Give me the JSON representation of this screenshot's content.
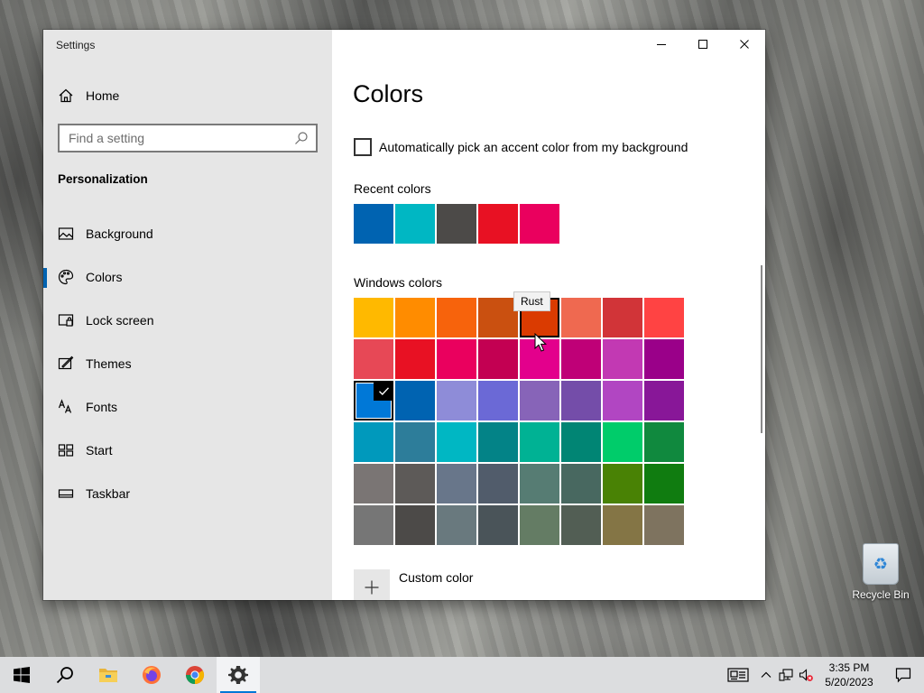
{
  "window": {
    "title": "Settings",
    "home_label": "Home",
    "search_placeholder": "Find a setting",
    "section_label": "Personalization",
    "nav_items": [
      {
        "label": "Background",
        "icon": "picture-icon"
      },
      {
        "label": "Colors",
        "icon": "palette-icon",
        "active": true
      },
      {
        "label": "Lock screen",
        "icon": "lock-screen-icon"
      },
      {
        "label": "Themes",
        "icon": "themes-icon"
      },
      {
        "label": "Fonts",
        "icon": "fonts-icon"
      },
      {
        "label": "Start",
        "icon": "start-icon"
      },
      {
        "label": "Taskbar",
        "icon": "taskbar-icon"
      }
    ],
    "caption_buttons": [
      "minimize",
      "maximize",
      "close"
    ]
  },
  "colors_page": {
    "title": "Colors",
    "auto_pick_label": "Automatically pick an accent color from my background",
    "auto_pick_checked": false,
    "recent_label": "Recent colors",
    "recent_colors": [
      "#0063b1",
      "#00b7c3",
      "#4c4a48",
      "#e81123",
      "#ea005e"
    ],
    "windows_label": "Windows colors",
    "windows_colors": [
      [
        "#ffb900",
        "#ff8c00",
        "#f7630c",
        "#ca5010",
        "#da3b01",
        "#ef6950",
        "#d13438",
        "#ff4343"
      ],
      [
        "#e74856",
        "#e81123",
        "#ea005e",
        "#c30052",
        "#e3008c",
        "#bf0077",
        "#c239b3",
        "#9a0089"
      ],
      [
        "#0078d7",
        "#0063b1",
        "#8e8cd8",
        "#6b69d6",
        "#8764b8",
        "#744da9",
        "#b146c2",
        "#881798"
      ],
      [
        "#0099bc",
        "#2d7d9a",
        "#00b7c3",
        "#038387",
        "#00b294",
        "#018574",
        "#00cc6a",
        "#10893e"
      ],
      [
        "#7a7574",
        "#5d5a58",
        "#68768a",
        "#515c6b",
        "#567c73",
        "#486860",
        "#498205",
        "#107c10"
      ],
      [
        "#767676",
        "#4c4a48",
        "#69797e",
        "#4a5459",
        "#647c64",
        "#525e54",
        "#847545",
        "#7e735f"
      ]
    ],
    "selected_color": {
      "row": 2,
      "col": 0
    },
    "hovered_color": {
      "row": 0,
      "col": 4
    },
    "tooltip": "Rust",
    "custom_color_label": "Custom color"
  },
  "desktop": {
    "recycle_bin_label": "Recycle Bin"
  },
  "taskbar": {
    "apps": [
      {
        "name": "start",
        "icon": "windows-logo-icon"
      },
      {
        "name": "search",
        "icon": "search-icon"
      },
      {
        "name": "file-explorer",
        "icon": "folder-icon"
      },
      {
        "name": "firefox",
        "icon": "firefox-icon"
      },
      {
        "name": "chrome",
        "icon": "chrome-icon"
      },
      {
        "name": "settings",
        "icon": "gear-icon",
        "active": true
      }
    ],
    "clock_time": "3:35 PM",
    "clock_date": "5/20/2023"
  }
}
